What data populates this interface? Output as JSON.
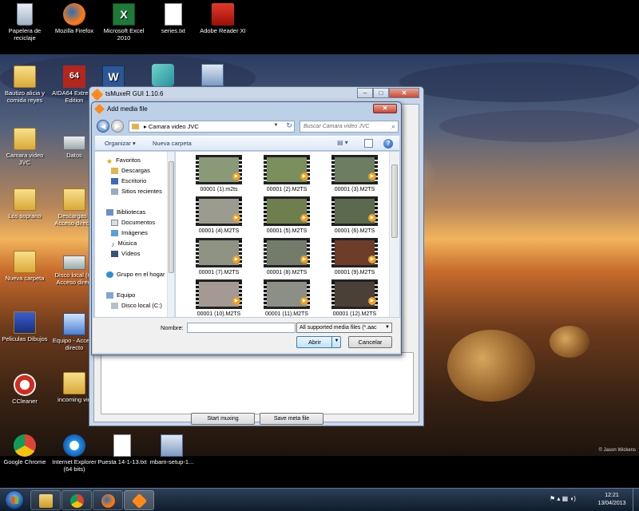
{
  "desktop": {
    "top_icons": [
      {
        "label": "Papelera de reciclaje",
        "icon": "recycle-bin-icon"
      },
      {
        "label": "Mozilla Firefox",
        "icon": "firefox-icon"
      },
      {
        "label": "Microsoft Excel 2010",
        "icon": "excel-icon"
      },
      {
        "label": "series.txt",
        "icon": "text-file-icon"
      },
      {
        "label": "Adobe Reader XI",
        "icon": "adobe-reader-icon"
      }
    ],
    "left_icons": [
      {
        "label": "Bautizo alicia y comida reyes",
        "icon": "folder-icon"
      },
      {
        "label": "AIDA64 Extreme Edition",
        "icon": "aida64-icon"
      },
      {
        "label": "Camara video JVC",
        "icon": "folder-icon"
      },
      {
        "label": "Datos",
        "icon": "drive-icon"
      },
      {
        "label": "Los soprano",
        "icon": "folder-icon"
      },
      {
        "label": "Descargas - Acceso directo",
        "icon": "folder-shortcut-icon"
      },
      {
        "label": "Nueva carpeta",
        "icon": "folder-icon"
      },
      {
        "label": "Disco local (C) Acceso direct",
        "icon": "drive-icon"
      },
      {
        "label": "Peliculas Dibujos",
        "icon": "folder-icon"
      },
      {
        "label": "Equipo - Acceso directo",
        "icon": "computer-icon"
      },
      {
        "label": "CCleaner",
        "icon": "ccleaner-icon"
      },
      {
        "label": "incoming vie",
        "icon": "folder-icon"
      }
    ],
    "bottom_icons": [
      {
        "label": "Google Chrome",
        "icon": "chrome-icon"
      },
      {
        "label": "Internet Explorer (64 bits)",
        "icon": "ie-icon"
      },
      {
        "label": "Puesta 14-1-13.txt",
        "icon": "text-file-icon"
      },
      {
        "label": "mbam-setup-1...",
        "icon": "installer-icon"
      }
    ],
    "credit": "© Jason Wickens"
  },
  "tsmuxer": {
    "title": "tsMuxeR GUI 1.10.6",
    "start_muxing": "Start muxing",
    "save_meta": "Save meta file"
  },
  "dialog": {
    "title": "Add media file",
    "address": "Camara video JVC",
    "search_placeholder": "Buscar Camara video JVC",
    "organize": "Organizar ▾",
    "new_folder": "Nueva carpeta",
    "nav": [
      {
        "label": "Favoritos",
        "kind": "star-icon",
        "indent": 0
      },
      {
        "label": "Descargas",
        "kind": "downloads-icon",
        "indent": 1
      },
      {
        "label": "Escritorio",
        "kind": "desktop-icon",
        "indent": 1
      },
      {
        "label": "Sitios recientes",
        "kind": "recent-icon",
        "indent": 1
      },
      {
        "label": "Bibliotecas",
        "kind": "library-icon",
        "indent": 0
      },
      {
        "label": "Documentos",
        "kind": "documents-icon",
        "indent": 1
      },
      {
        "label": "Imágenes",
        "kind": "pictures-icon",
        "indent": 1
      },
      {
        "label": "Música",
        "kind": "music-icon",
        "indent": 1
      },
      {
        "label": "Vídeos",
        "kind": "videos-icon",
        "indent": 1
      },
      {
        "label": "Grupo en el hogar",
        "kind": "homegroup-icon",
        "indent": 0
      },
      {
        "label": "Equipo",
        "kind": "computer-icon",
        "indent": 0
      },
      {
        "label": "Disco local (C:)",
        "kind": "drive-icon",
        "indent": 1
      }
    ],
    "files": [
      {
        "name": "00001 (1).m2ts",
        "color": "#8a9a78"
      },
      {
        "name": "00001 (2).M2TS",
        "color": "#7a8f5c"
      },
      {
        "name": "00001 (3).M2TS",
        "color": "#6d7d62"
      },
      {
        "name": "00001 (4).M2TS",
        "color": "#9b9b8f"
      },
      {
        "name": "00001 (5).M2TS",
        "color": "#6f7e4e"
      },
      {
        "name": "00001 (6).M2TS",
        "color": "#5b6a4e"
      },
      {
        "name": "00001 (7).M2TS",
        "color": "#8f9384"
      },
      {
        "name": "00001 (8).M2TS",
        "color": "#737b6a"
      },
      {
        "name": "00001 (9).M2TS",
        "color": "#6e3d2a"
      },
      {
        "name": "00001 (10).M2TS",
        "color": "#a59a93"
      },
      {
        "name": "00001 (11).M2TS",
        "color": "#8c8f86"
      },
      {
        "name": "00001 (12).M2TS",
        "color": "#4a4038"
      }
    ],
    "name_label": "Nombre:",
    "name_value": "",
    "file_type": "All supported media files (*.aac",
    "open": "Abrir",
    "cancel": "Cancelar"
  },
  "taskbar": {
    "apps": [
      "explorer-icon",
      "chrome-icon",
      "firefox-icon",
      "tsmuxer-icon"
    ],
    "time": "12:21",
    "date": "13/04/2013"
  }
}
